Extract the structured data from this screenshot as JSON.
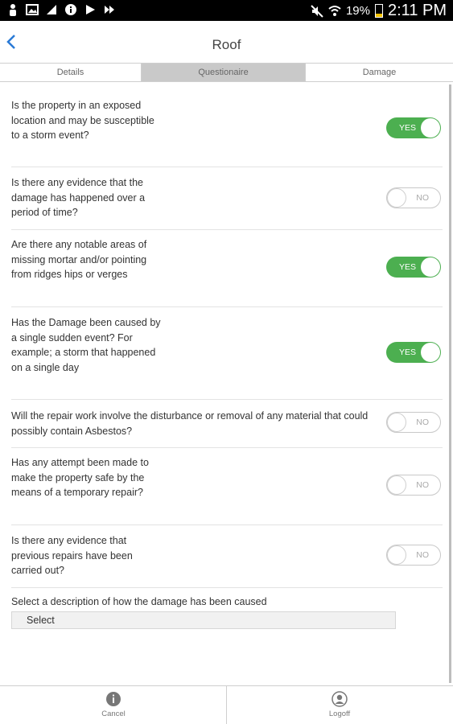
{
  "status_bar": {
    "battery_pct": "19%",
    "time": "2:11 PM",
    "left_icons": [
      "person-icon",
      "image-icon",
      "signal-app-icon",
      "info-icon",
      "play-icon",
      "forward-icon"
    ],
    "right_icons": [
      "mute-icon",
      "wifi-icon",
      "battery-icon"
    ]
  },
  "header": {
    "title": "Roof",
    "back_icon": "chevron-left-icon",
    "accent": "#2a7ad6"
  },
  "tabs": [
    {
      "label": "Details",
      "active": false
    },
    {
      "label": "Questionaire",
      "active": true
    },
    {
      "label": "Damage",
      "active": false
    }
  ],
  "questions": [
    {
      "text": "Is the property in an exposed location and may be susceptible to a storm event?",
      "state": "YES"
    },
    {
      "text": "Is there any evidence that the damage has happened over a period of time?",
      "state": "NO"
    },
    {
      "text": "Are there any notable areas of missing mortar and/or pointing from ridges hips or verges",
      "state": "YES"
    },
    {
      "text": "Has the Damage been caused by a single sudden event? For example; a storm that happened on a single day",
      "state": "YES"
    },
    {
      "text": "Will the repair work involve the disturbance or removal of any material that could possibly contain Asbestos?",
      "state": "NO"
    },
    {
      "text": "Has any attempt been made to make the property safe by the means of a temporary repair?",
      "state": "NO"
    },
    {
      "text": "Is there any evidence that previous repairs have been carried out?",
      "state": "NO"
    }
  ],
  "cause_select": {
    "label": "Select a description of how the damage has been caused",
    "value": "Select"
  },
  "bottom_bar": {
    "cancel_label": "Cancel",
    "logoff_label": "Logoff"
  },
  "colors": {
    "toggle_on": "#4caf50",
    "tab_active": "#c9c9c9"
  }
}
